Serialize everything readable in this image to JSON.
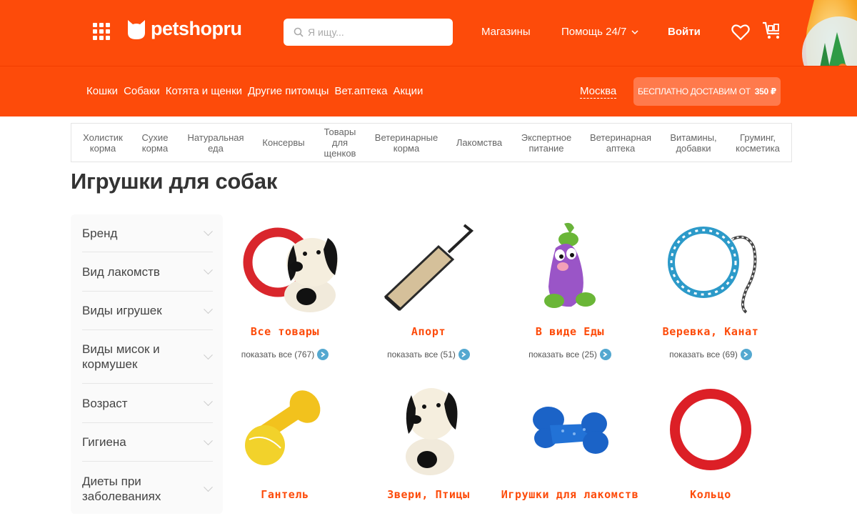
{
  "header": {
    "logo_text": "petshopru",
    "search_placeholder": "Я ищу...",
    "stores": "Магазины",
    "help": "Помощь 24/7",
    "login": "Войти"
  },
  "nav": {
    "items": [
      "Кошки",
      "Собаки",
      "Котята и щенки",
      "Другие питомцы",
      "Вет.аптека",
      "Акции"
    ],
    "city": "Москва",
    "delivery_text": "БЕСПЛАТНО ДОСТАВИМ ОТ",
    "delivery_amount": "350 ₽"
  },
  "categories": [
    "Холистик корма",
    "Сухие корма",
    "Натуральная еда",
    "Консервы",
    "Товары для щенков",
    "Ветеринарные корма",
    "Лакомства",
    "Экспертное питание",
    "Ветеринарная аптека",
    "Витамины, добавки",
    "Груминг, косметика"
  ],
  "page_title": "Игрушки для собак",
  "filters": [
    "Бренд",
    "Вид лакомств",
    "Виды игрушек",
    "Виды мисок и кормушек",
    "Возраст",
    "Гигиена",
    "Диеты при заболеваниях"
  ],
  "products": [
    {
      "title": "Все товары",
      "more": "показать все (767)",
      "image": "ring-and-dog-toy"
    },
    {
      "title": "Апорт",
      "more": "показать все (51)",
      "image": "jute-tug-toy"
    },
    {
      "title": "В виде Еды",
      "more": "показать все (25)",
      "image": "eggplant-toy"
    },
    {
      "title": "Веревка, Канат",
      "more": "показать все (69)",
      "image": "rope-ring-toy"
    },
    {
      "title": "Гантель",
      "more": "",
      "image": "dumbbell-toy"
    },
    {
      "title": "Звери, Птицы",
      "more": "",
      "image": "dog-figure-toy"
    },
    {
      "title": "Игрушки для лакомств",
      "more": "",
      "image": "blue-bone-toy"
    },
    {
      "title": "Кольцо",
      "more": "",
      "image": "red-ring-toy"
    }
  ],
  "colors": {
    "brand": "#fd4b0a",
    "accent_blue": "#54a8d0"
  }
}
